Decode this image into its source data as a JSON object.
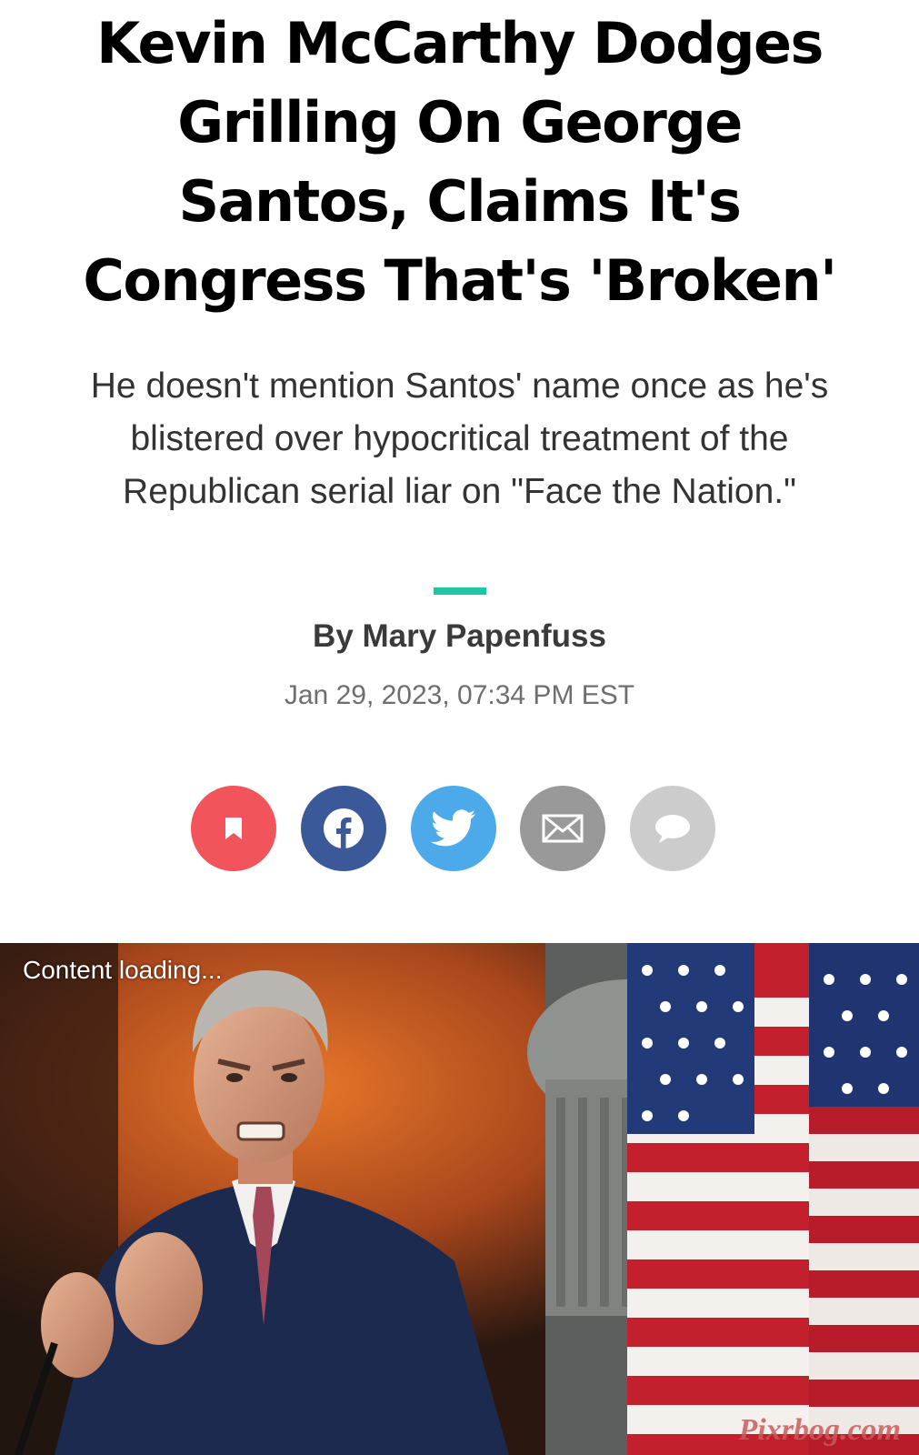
{
  "article": {
    "headline": "Kevin McCarthy Dodges Grilling On George Santos, Claims It's Congress That's 'Broken'",
    "dek": "He doesn't mention Santos' name once as he's blistered over hypocritical treatment of the Republican serial liar on \"Face the Nation.\"",
    "byline": "By Mary Papenfuss",
    "timestamp": "Jan 29, 2023, 07:34 PM EST",
    "accent_color": "#1fc6a6"
  },
  "share": {
    "buttons": [
      {
        "name": "bookmark",
        "icon": "bookmark-icon",
        "color": "#f2545b"
      },
      {
        "name": "facebook",
        "icon": "facebook-icon",
        "color": "#3b5898"
      },
      {
        "name": "twitter",
        "icon": "twitter-icon",
        "color": "#4daaea"
      },
      {
        "name": "email",
        "icon": "email-icon",
        "color": "#999999"
      },
      {
        "name": "comment",
        "icon": "comment-icon",
        "color": "#cccccc"
      }
    ]
  },
  "hero": {
    "loading_text": "Content loading...",
    "watermark": "Pixrbog.com"
  }
}
